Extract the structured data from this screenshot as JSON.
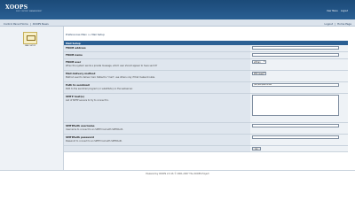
{
  "header": {
    "logo": "XOOPS",
    "logo_sub": "PHP CONTENT MANAGEMENT",
    "user_links": [
      "User Menu",
      "Logout"
    ]
  },
  "nav": {
    "left": [
      "Control Panel Home",
      "XOOPS News"
    ],
    "right": [
      "Logout",
      "Home Page"
    ],
    "sep": "|"
  },
  "module": {
    "label": "MAIL SETUP"
  },
  "breadcrumb": "Preferences Main »» Mail Setup",
  "form": {
    "title": "Mail Setup",
    "from_address": {
      "label": "FROM address",
      "value": ""
    },
    "from_name": {
      "label": "FROM name",
      "value": ""
    },
    "from_user": {
      "label": "FROM user",
      "desc": "When the system sends a private message, which user should appear to have sent it?",
      "value": "elfman"
    },
    "mail_method": {
      "label": "Mail delivery method",
      "desc": "Method used to deliver mail. Default is \"mail\", use others only if that makes trouble.",
      "value": "PHP mail()"
    },
    "sendmail_path": {
      "label": "Path to sendmail",
      "desc": "Path to the sendmail program (or substitute) on the webserver.",
      "value": "/usr/sbin/sendmail"
    },
    "smtp_hosts": {
      "label": "SMTP host(s)",
      "desc": "List of SMTP servers to try to connect to."
    },
    "smtp_user": {
      "label": "SMTPAuth username",
      "desc": "Username to connect to an SMTP host with SMTPAuth.",
      "value": ""
    },
    "smtp_pass": {
      "label": "SMTPAuth password",
      "desc": "Password to connect to an SMTP host with SMTPAuth.",
      "value": ""
    },
    "go_label": "Go"
  },
  "footer": "Powered by XOOPS 2.0.16 © 2001-2007 The XOOPS Project"
}
